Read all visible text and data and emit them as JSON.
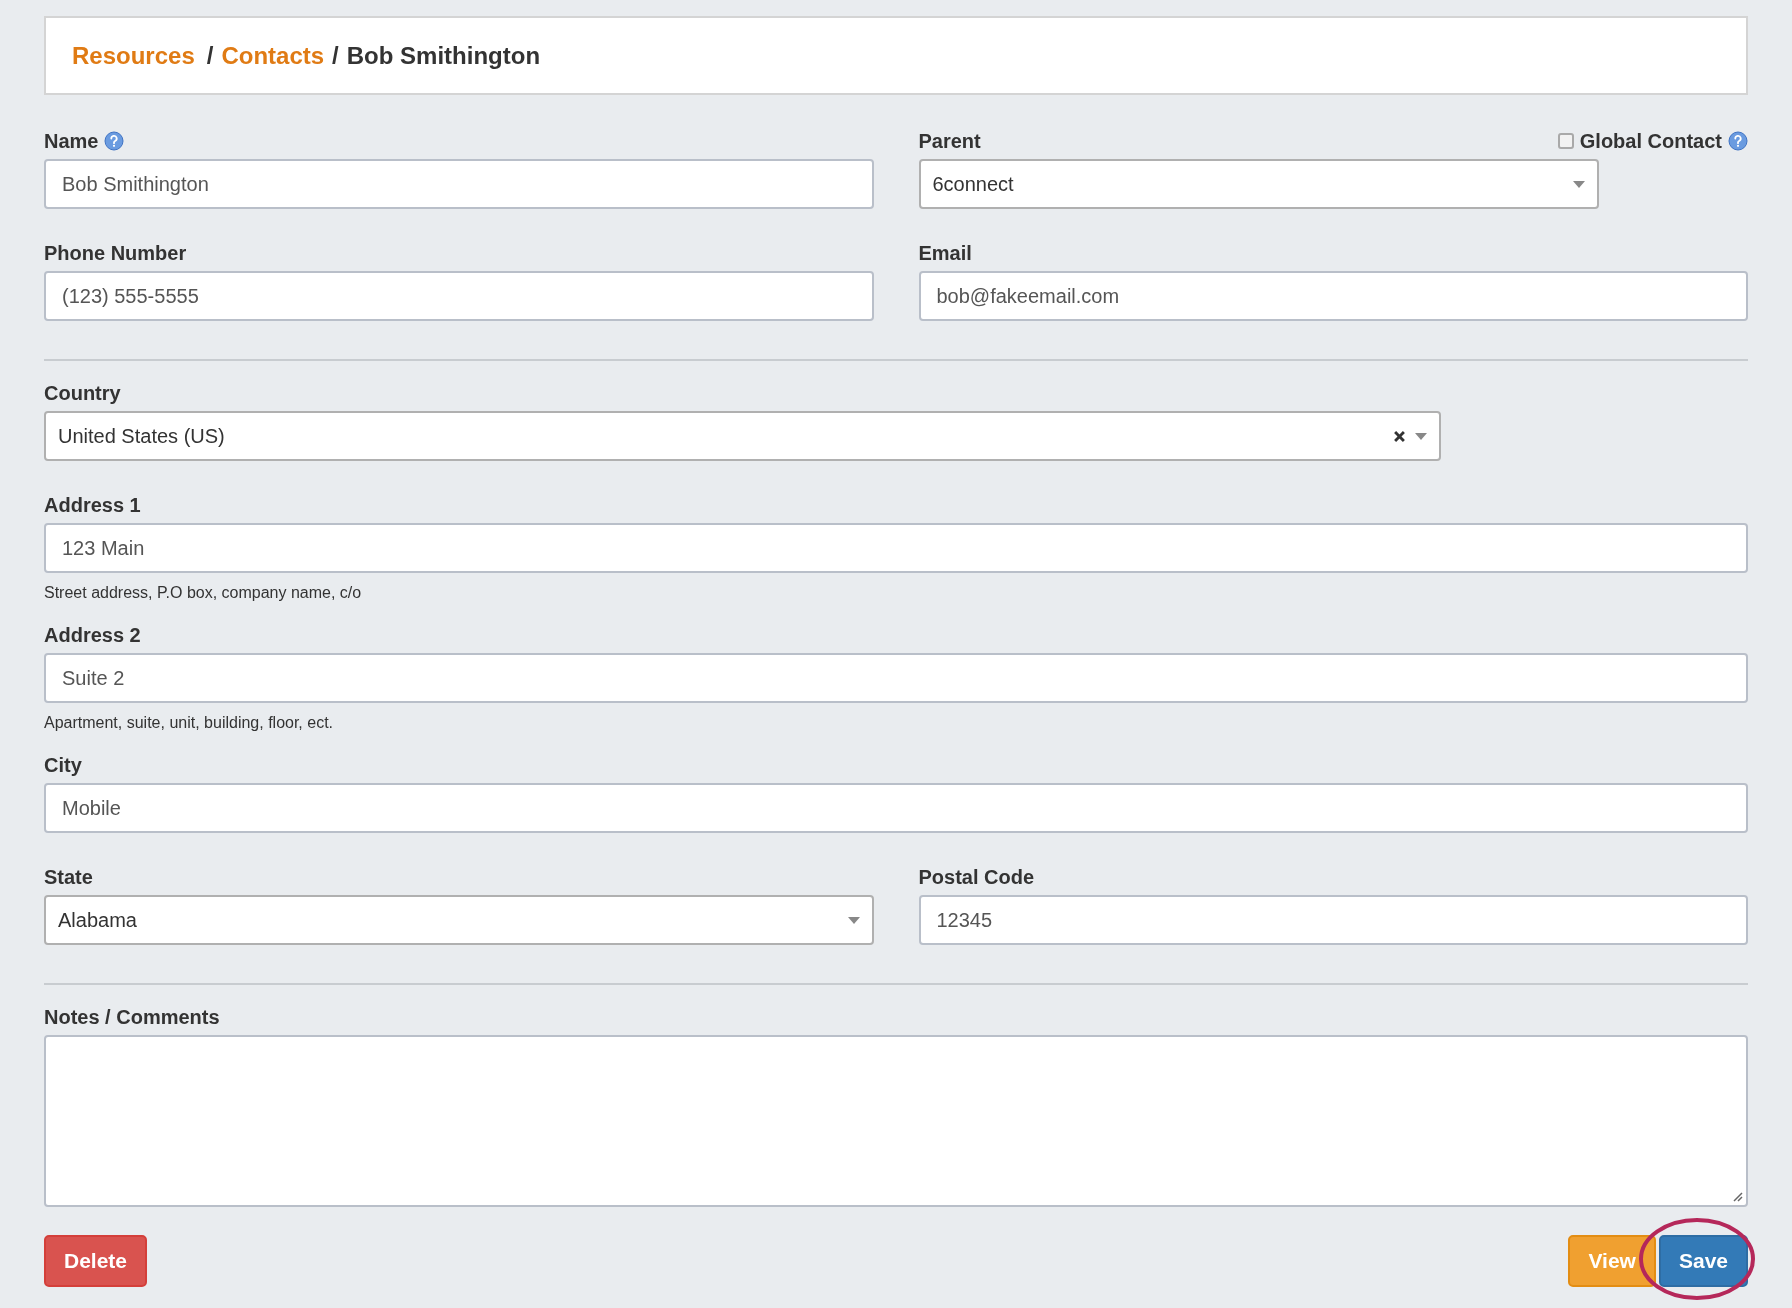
{
  "breadcrumb": [
    {
      "text": "Resources",
      "kind": "link"
    },
    {
      "text": "/",
      "kind": "separator"
    },
    {
      "text": "Contacts",
      "kind": "link"
    },
    {
      "text": "/",
      "kind": "separator"
    },
    {
      "text": "Bob Smithington",
      "kind": "current"
    }
  ],
  "sections": [
    [
      [
        {
          "label": "Name",
          "kind": "text",
          "value": "Bob Smithington",
          "help": true
        },
        {
          "label": "Parent",
          "kind": "select",
          "value": "6connect",
          "option": {
            "label": "Global Contact",
            "checked": false,
            "help": true
          }
        }
      ],
      [
        {
          "label": "Phone Number",
          "kind": "text",
          "value": "(123) 555-5555"
        },
        {
          "label": "Email",
          "kind": "text",
          "value": "bob@fakeemail.com"
        }
      ]
    ],
    [
      [
        {
          "label": "Country",
          "kind": "clearable-select",
          "value": "United States (US)"
        }
      ],
      [
        {
          "label": "Address 1",
          "kind": "text",
          "value": "123 Main",
          "hint": "Street address, P.O box, company name, c/o"
        }
      ],
      [
        {
          "label": "Address 2",
          "kind": "text",
          "value": "Suite 2",
          "hint": "Apartment, suite, unit, building, floor, ect."
        }
      ],
      [
        {
          "label": "City",
          "kind": "text",
          "value": "Mobile"
        }
      ],
      [
        {
          "label": "State",
          "kind": "select",
          "value": "Alabama"
        },
        {
          "label": "Postal Code",
          "kind": "text",
          "value": "12345"
        }
      ]
    ],
    [
      [
        {
          "label": "Notes / Comments",
          "kind": "textarea"
        }
      ]
    ]
  ],
  "buttons": [
    {
      "label": "Delete",
      "kind": "danger",
      "highlighted": false
    },
    {
      "label": "View",
      "kind": "warning",
      "highlighted": false
    },
    {
      "label": "Save",
      "kind": "primary",
      "highlighted": true
    }
  ]
}
